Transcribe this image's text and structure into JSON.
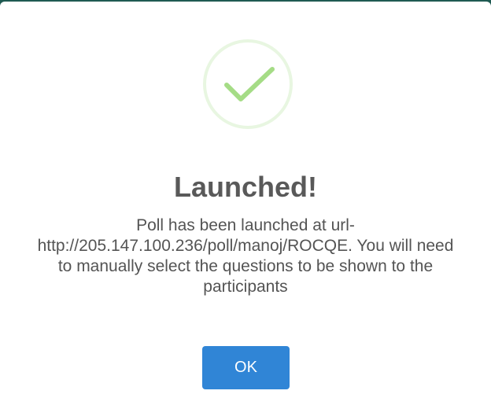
{
  "dialog": {
    "icon": "success-check-icon",
    "title": "Launched!",
    "message_line1": "Poll has been launched at url-",
    "message_line2": "http://205.147.100.236/poll/manoj/ROCQE. You will need",
    "message_line3": "to manually select the questions to be shown to the",
    "message_line4": "participants",
    "confirm_label": "OK"
  },
  "colors": {
    "success": "#a5dc86",
    "confirm_button": "#3085d6",
    "title_text": "#595959",
    "message_text": "#545454",
    "backdrop": "#1f5a52"
  }
}
